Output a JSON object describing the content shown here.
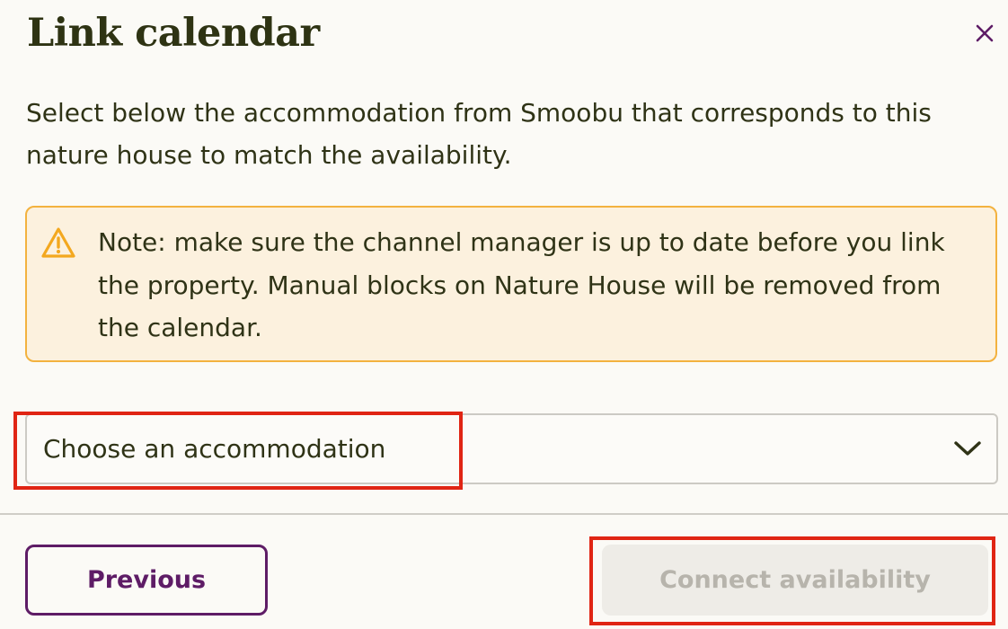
{
  "dialog": {
    "title": "Link calendar",
    "description": "Select below the accommodation from Smoobu that corresponds to this nature house to match the availability.",
    "close_icon": "close-icon"
  },
  "note": {
    "icon": "warning-triangle-icon",
    "text": "Note: make sure the channel manager is up to date before you link the property. Manual blocks on Nature House will be removed from the calendar."
  },
  "accommodation_select": {
    "placeholder": "Choose an accommodation",
    "icon": "chevron-down-icon"
  },
  "footer": {
    "previous_label": "Previous",
    "connect_label": "Connect availability",
    "connect_disabled": true
  },
  "colors": {
    "title": "#2e3313",
    "text": "#2f3316",
    "accent_purple": "#5e1c66",
    "note_background": "#fcf1de",
    "note_border": "#f3b23f",
    "disabled_button_background": "#eeece7",
    "disabled_button_text": "#b7b4ac",
    "annotation_red": "#e02514"
  }
}
